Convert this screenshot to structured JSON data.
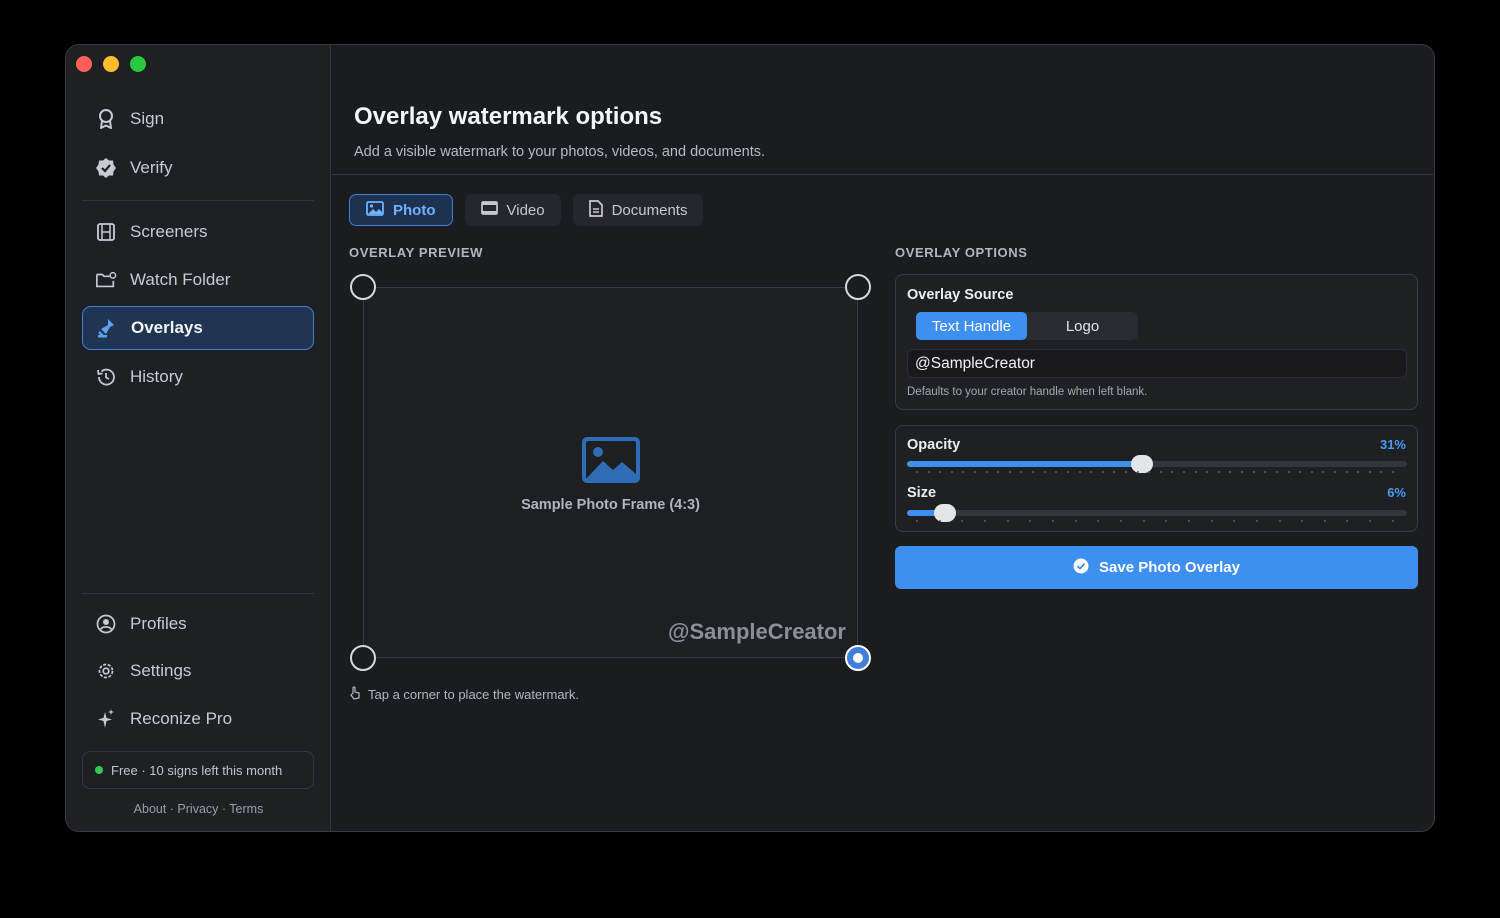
{
  "sidebar": {
    "nav": [
      {
        "label": "Sign",
        "icon": "award-icon"
      },
      {
        "label": "Verify",
        "icon": "verified-badge-icon"
      },
      {
        "label": "Screeners",
        "icon": "film-icon"
      },
      {
        "label": "Watch Folder",
        "icon": "folder-gear-icon"
      },
      {
        "label": "Overlays",
        "icon": "stamp-icon",
        "active": true
      },
      {
        "label": "History",
        "icon": "history-icon"
      }
    ],
    "bottom_nav": [
      {
        "label": "Profiles",
        "icon": "person-circle-icon"
      },
      {
        "label": "Settings",
        "icon": "gear-icon"
      },
      {
        "label": "Reconize Pro",
        "icon": "sparkle-icon"
      }
    ],
    "plan_status": "Free · 10 signs left this month",
    "footer_links": "About · Privacy · Terms"
  },
  "header": {
    "title": "Overlay watermark options",
    "subtitle": "Add a visible watermark to your photos, videos, and documents."
  },
  "tabs": [
    {
      "label": "Photo",
      "icon": "photo-icon",
      "active": true
    },
    {
      "label": "Video",
      "icon": "video-icon"
    },
    {
      "label": "Documents",
      "icon": "document-icon"
    }
  ],
  "preview": {
    "section_label": "OVERLAY PREVIEW",
    "frame_label": "Sample Photo Frame (4:3)",
    "watermark_text": "@SampleCreator",
    "selected_corner": "bottom-right",
    "hint": "Tap a corner to place the watermark."
  },
  "options": {
    "section_label": "OVERLAY OPTIONS",
    "source": {
      "title": "Overlay Source",
      "segments": [
        "Text Handle",
        "Logo"
      ],
      "selected": "Text Handle",
      "input_value": "@SampleCreator",
      "helper": "Defaults to your creator handle when left blank."
    },
    "opacity": {
      "label": "Opacity",
      "value_text": "31%",
      "value": 0.47
    },
    "size": {
      "label": "Size",
      "value_text": "6%",
      "value": 0.075
    },
    "save_label": "Save Photo Overlay"
  },
  "colors": {
    "accent": "#3d8ff0",
    "background": "#1b1c20",
    "sidebar": "#1f2024"
  }
}
